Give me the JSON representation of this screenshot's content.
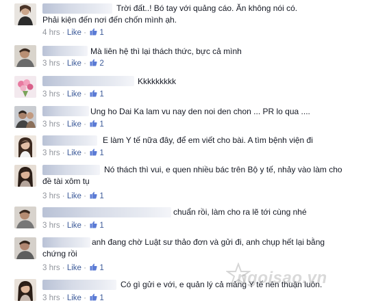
{
  "comments": [
    {
      "text": "Trời đất..! Bó tay với quảng cáo. Ăn không nói có.",
      "text2": "Phải kiện đến nơi đến chốn mình ạh.",
      "time": "4 hrs",
      "like": "Like",
      "likes": "1"
    },
    {
      "text": "Mà liên hệ thì lại thách thức, bực cả mình",
      "time": "3 hrs",
      "like": "Like",
      "likes": "2"
    },
    {
      "text": "Kkkkkkkkk",
      "time": "3 hrs",
      "like": "Like",
      "likes": "1"
    },
    {
      "text": "Ung ho Dai Ka lam vu nay den noi den chon ... PR lo qua ....",
      "time": "3 hrs",
      "like": "Like",
      "likes": "1"
    },
    {
      "text": "E làm Y tế nữa đây, để em viết cho bài. A tìm bệnh viện đi",
      "time": "3 hrs",
      "like": "Like",
      "likes": "1"
    },
    {
      "text": "Nó thách thì vui, e quen nhiều bác trên Bộ y tế, nhảy vào làm cho",
      "text2": "đề tài xôm tụ",
      "time": "3 hrs",
      "like": "Like",
      "likes": "1"
    },
    {
      "text": "chuẩn rồi, làm cho ra lẽ tới cùng nhé",
      "time": "3 hrs",
      "like": "Like",
      "likes": "1"
    },
    {
      "text": "anh đang chờ Luật sư thảo đơn và gửi đi, anh chụp hết lại bằng",
      "text2": "chứng rồi",
      "time": "3 hrs",
      "like": "Like",
      "likes": "1"
    },
    {
      "text": "Có gì gửi e với, e quản lý cả mảng Y tế nên thuận luôn.",
      "time": "3 hrs",
      "like": "Like",
      "likes": "1"
    }
  ],
  "separator": "·",
  "watermark": "ngoisao.vn",
  "colors": {
    "link": "#3b5998",
    "meta": "#90949c",
    "text": "#141823"
  }
}
